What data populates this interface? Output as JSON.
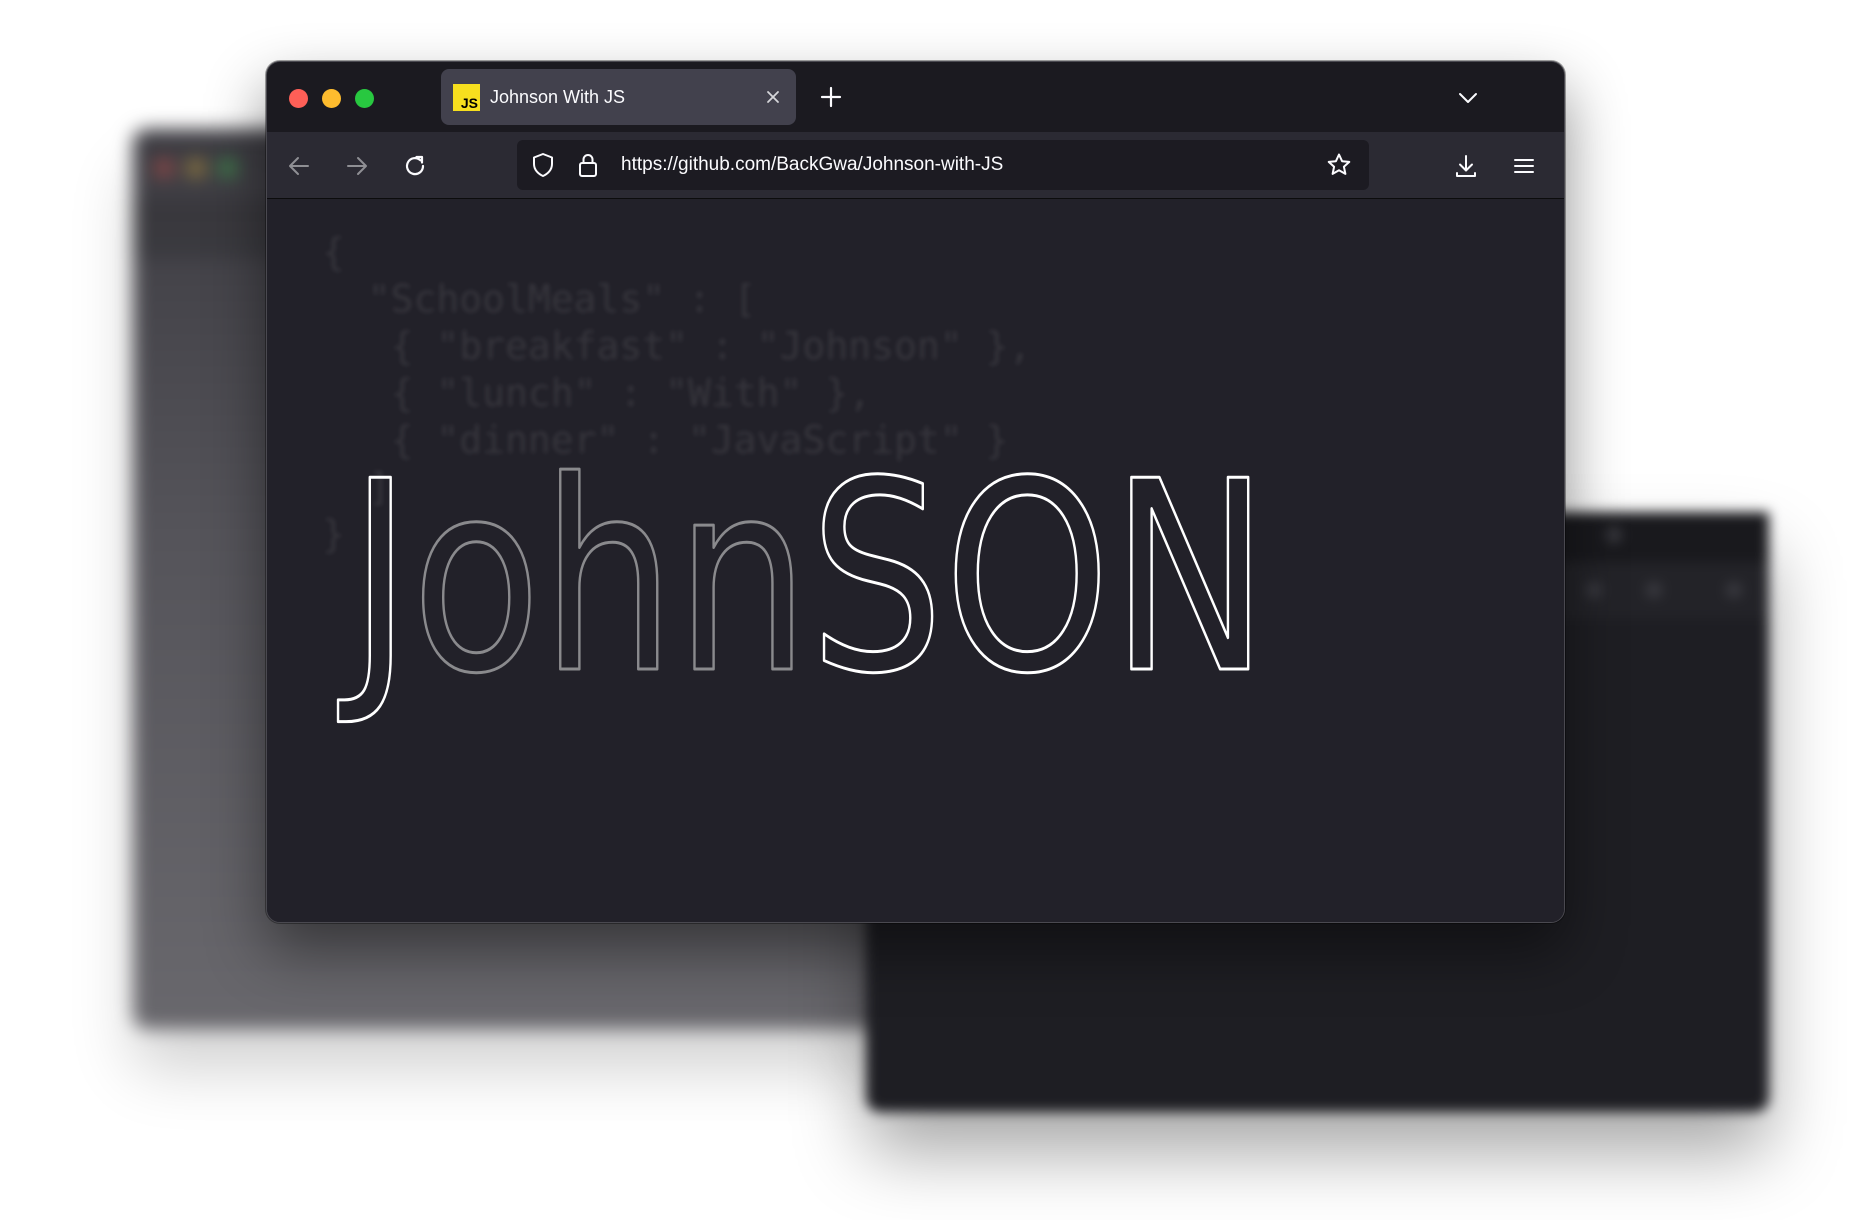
{
  "window": {
    "traffic_lights": {
      "close": "#fe5f57",
      "minimize": "#febc2e",
      "maximize": "#28c840"
    }
  },
  "tabs": [
    {
      "title": "Johnson With JS",
      "favicon_text": "JS",
      "favicon_color": "#f7df1e",
      "active": true
    }
  ],
  "toolbar": {
    "icons": [
      "back-icon",
      "forward-icon",
      "reload-icon",
      "shield-icon",
      "lock-icon",
      "star-icon",
      "download-icon",
      "menu-icon"
    ]
  },
  "urlbar": {
    "url": "https://github.com/BackGwa/Johnson-with-JS"
  },
  "page": {
    "background": "#222129",
    "logo": {
      "parts": [
        {
          "text": "J",
          "stroke": "#ffffff"
        },
        {
          "text": "ohn",
          "stroke": "#8a8a8d"
        },
        {
          "text": "SON",
          "stroke": "#ffffff"
        }
      ]
    },
    "code_lines": [
      "{",
      "  \"SchoolMeals\" : [",
      "   { \"breakfast\" : \"Johnson\" },",
      "   { \"lunch\" : \"With\" },",
      "   { \"dinner\" : \"JavaScript\" }",
      "  ]",
      "}"
    ]
  }
}
